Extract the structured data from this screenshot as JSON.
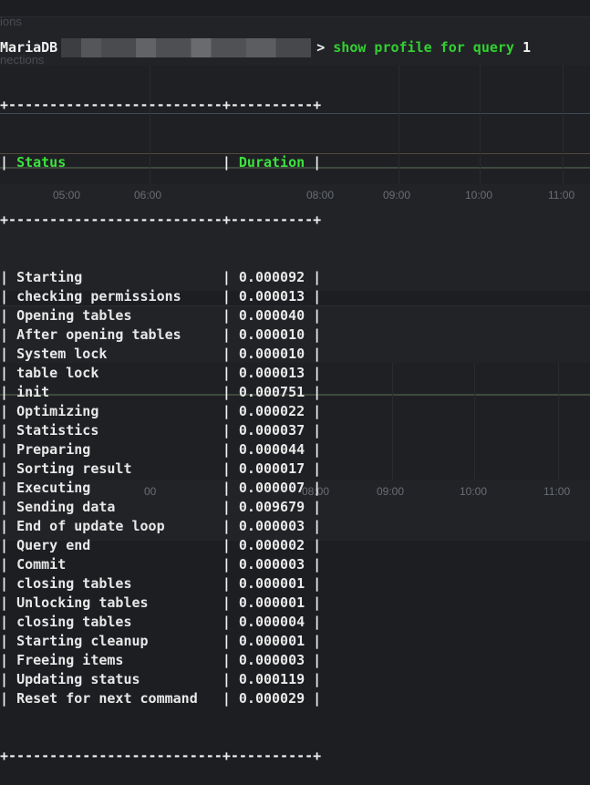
{
  "terminal": {
    "client_name": "MariaDB",
    "prompt_symbol": ">",
    "command": "show profile for query",
    "command_arg": "1",
    "border": "+--------------------------+----------+",
    "headers": {
      "status": "Status",
      "duration": "Duration"
    },
    "rows": [
      {
        "status": "Starting",
        "duration": "0.000092"
      },
      {
        "status": "checking permissions",
        "duration": "0.000013"
      },
      {
        "status": "Opening tables",
        "duration": "0.000040"
      },
      {
        "status": "After opening tables",
        "duration": "0.000010"
      },
      {
        "status": "System lock",
        "duration": "0.000010"
      },
      {
        "status": "table lock",
        "duration": "0.000013"
      },
      {
        "status": "init",
        "duration": "0.000751"
      },
      {
        "status": "Optimizing",
        "duration": "0.000022"
      },
      {
        "status": "Statistics",
        "duration": "0.000037"
      },
      {
        "status": "Preparing",
        "duration": "0.000044"
      },
      {
        "status": "Sorting result",
        "duration": "0.000017"
      },
      {
        "status": "Executing",
        "duration": "0.000007"
      },
      {
        "status": "Sending data",
        "duration": "0.009679"
      },
      {
        "status": "End of update loop",
        "duration": "0.000003"
      },
      {
        "status": "Query end",
        "duration": "0.000002"
      },
      {
        "status": "Commit",
        "duration": "0.000003"
      },
      {
        "status": "closing tables",
        "duration": "0.000001"
      },
      {
        "status": "Unlocking tables",
        "duration": "0.000001"
      },
      {
        "status": "closing tables",
        "duration": "0.000004"
      },
      {
        "status": "Starting cleanup",
        "duration": "0.000001"
      },
      {
        "status": "Freeing items",
        "duration": "0.000003"
      },
      {
        "status": "Updating status",
        "duration": "0.000119"
      },
      {
        "status": "Reset for next command",
        "duration": "0.000029"
      }
    ]
  },
  "background": {
    "panel1_title": "ions",
    "panel1_subtitle": "nections",
    "ticks_top": [
      "05:00",
      "06:00",
      "08:00",
      "09:00",
      "10:00",
      "11:00"
    ],
    "ticks_bottom": [
      "00",
      "08:00",
      "09:00",
      "10:00",
      "11:00"
    ]
  },
  "colors": {
    "command": "#32d032",
    "header": "#3ce23c",
    "text": "#e8e8e8",
    "background": "#1d1e22"
  }
}
